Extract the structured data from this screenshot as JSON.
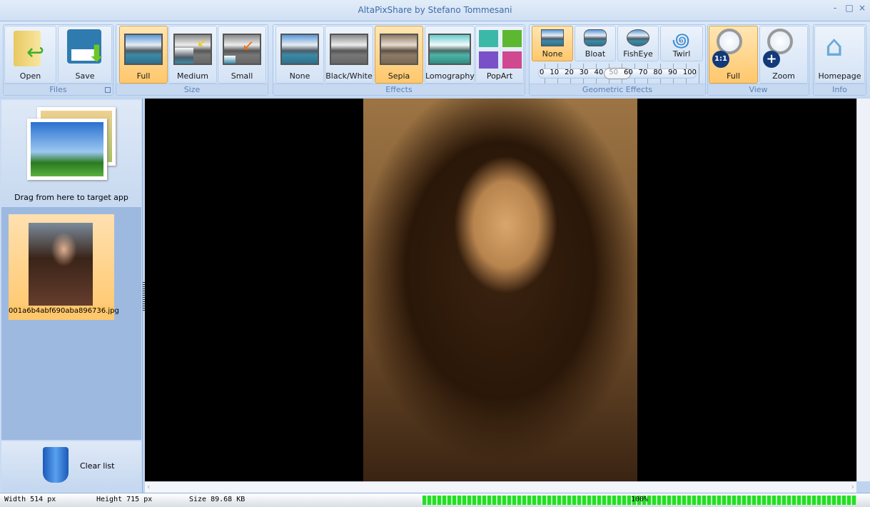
{
  "title": "AltaPixShare by Stefano Tommesani",
  "window_controls": [
    "-",
    "□",
    "×"
  ],
  "ribbon": {
    "files": {
      "label": "Files",
      "open": "Open",
      "save": "Save"
    },
    "size": {
      "label": "Size",
      "full": "Full",
      "medium": "Medium",
      "small": "Small",
      "selected": "Full"
    },
    "effects": {
      "label": "Effects",
      "none": "None",
      "bw": "Black/White",
      "sepia": "Sepia",
      "lomo": "Lomography",
      "popart": "PopArt",
      "selected": "Sepia"
    },
    "geometric": {
      "label": "Geometric Effects",
      "none": "None",
      "bloat": "Bloat",
      "fisheye": "FishEye",
      "twirl": "Twirl",
      "selected": "None",
      "slider_ticks": [
        "0",
        "10",
        "20",
        "30",
        "40",
        "50",
        "60",
        "70",
        "80",
        "90",
        "100"
      ],
      "slider_value": 50
    },
    "view": {
      "label": "View",
      "full": "Full",
      "zoom": "Zoom",
      "selected": "Full"
    },
    "info": {
      "label": "Info",
      "homepage": "Homepage"
    }
  },
  "left": {
    "drag_text": "Drag from here to target app",
    "files": [
      {
        "name": "001a6b4abf690aba896736.jpg"
      }
    ],
    "clear": "Clear list"
  },
  "status": {
    "width": "Width 514 px",
    "height": "Height 715 px",
    "size": "Size 89.68 KB",
    "progress_text": "100%",
    "progress": 100
  },
  "colors": {
    "selected": "#ffc76b",
    "progress": "#22e022"
  }
}
